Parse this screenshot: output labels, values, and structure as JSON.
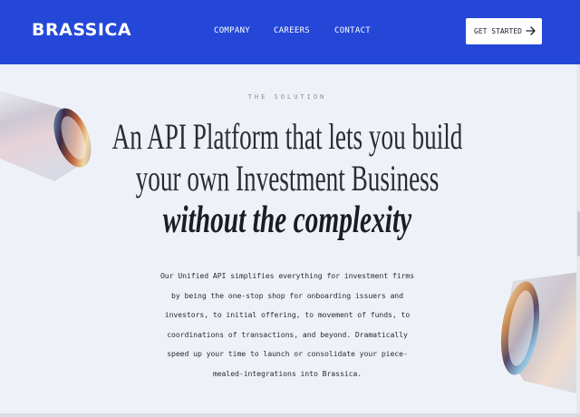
{
  "header": {
    "logo": "BRASSICA",
    "nav": [
      "COMPANY",
      "CAREERS",
      "CONTACT"
    ],
    "cta_label": "GET STARTED",
    "bg_color": "#2447d8"
  },
  "hero": {
    "eyebrow": "THE SOLUTION",
    "headline_lines": [
      "An API Platform that lets you build",
      "your own Investment Business"
    ],
    "headline_emphasis": "without the complexity",
    "body_lines": [
      "Our Unified API simplifies everything for investment firms",
      "by being the one-stop shop for onboarding issuers and",
      "investors, to initial offering, to movement of funds, to",
      "coordinations of transactions, and beyond. Dramatically",
      "speed up your time to launch or consolidate your piece-",
      "mealed-integrations into Brassica."
    ]
  },
  "icons": {
    "cta": "arrow-right-icon",
    "decor_left": "glass-tube",
    "decor_right": "glass-tube"
  }
}
